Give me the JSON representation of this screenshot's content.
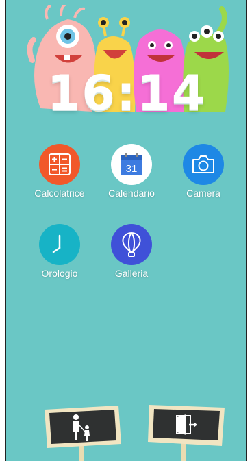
{
  "clock": {
    "time": "16:14"
  },
  "apps": [
    {
      "label": "Calcolatrice",
      "icon": "calculator-icon",
      "color": "#f1582a"
    },
    {
      "label": "Calendario",
      "icon": "calendar-icon",
      "color": "#ffffff",
      "day": "31"
    },
    {
      "label": "Camera",
      "icon": "camera-icon",
      "color": "#1e88e5"
    },
    {
      "label": "Orologio",
      "icon": "clock-icon",
      "color": "#17b3c6"
    },
    {
      "label": "Galleria",
      "icon": "balloon-icon",
      "color": "#3f51d8"
    }
  ],
  "bottom": {
    "left_sign": {
      "icon": "parent-child-icon"
    },
    "right_sign": {
      "icon": "exit-door-icon"
    }
  },
  "colors": {
    "background": "#6ac7c5",
    "sign_board": "#2f3131",
    "sign_frame": "#f1e5c2"
  }
}
